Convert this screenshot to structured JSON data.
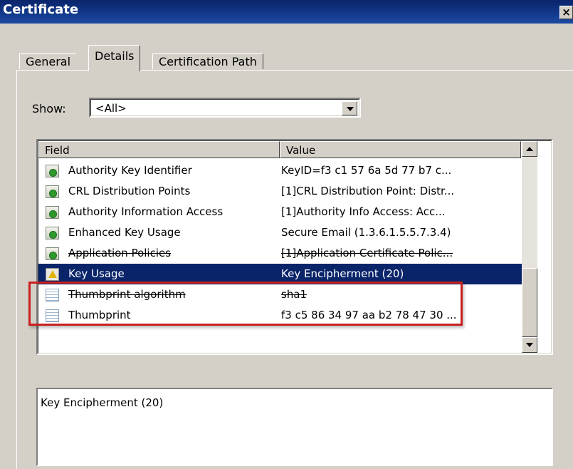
{
  "window": {
    "title": "Certificate",
    "close_glyph": "×"
  },
  "tabs": [
    {
      "label": "General",
      "selected": false
    },
    {
      "label": "Details",
      "selected": true
    },
    {
      "label": "Certification Path",
      "selected": false
    }
  ],
  "show": {
    "label": "Show:",
    "value": "<All>"
  },
  "list": {
    "columns": [
      "Field",
      "Value"
    ],
    "rows": [
      {
        "icon": "cert-extension-icon",
        "field": "Authority Key Identifier",
        "value": "KeyID=f3 c1 57 6a 5d 77 b7 c..."
      },
      {
        "icon": "cert-extension-icon",
        "field": "CRL Distribution Points",
        "value": "[1]CRL Distribution Point: Distr..."
      },
      {
        "icon": "cert-extension-icon",
        "field": "Authority Information Access",
        "value": "[1]Authority Info Access: Acc..."
      },
      {
        "icon": "cert-extension-icon",
        "field": "Enhanced Key Usage",
        "value": "Secure Email (1.3.6.1.5.5.7.3.4)"
      },
      {
        "icon": "cert-extension-icon",
        "field": "Application Policies",
        "value": "[1]Application Certificate Polic..."
      },
      {
        "icon": "warning-icon",
        "field": "Key Usage",
        "value": "Key Encipherment (20)",
        "selected": true
      },
      {
        "icon": "document-icon",
        "field": "Thumbprint algorithm",
        "value": "sha1"
      },
      {
        "icon": "document-icon",
        "field": "Thumbprint",
        "value": "f3 c5 86 34 97 aa b2 78 47 30 ..."
      }
    ]
  },
  "detail_text": "Key Encipherment (20)",
  "colors": {
    "selection": "#0a246a",
    "highlight_box": "#c8201f",
    "title_bar": "#0a246a"
  }
}
